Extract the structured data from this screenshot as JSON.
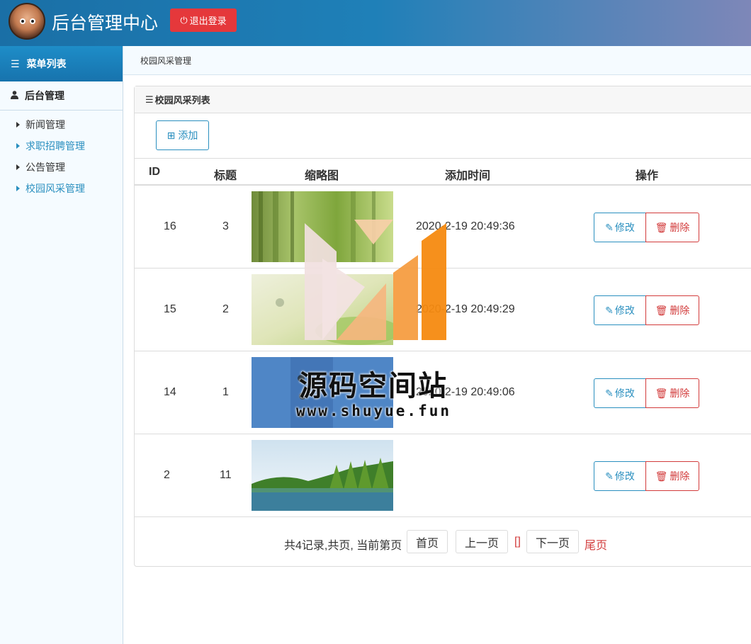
{
  "header": {
    "title": "后台管理中心",
    "logout_label": "退出登录",
    "avatar_icon": "cartoon-boy-avatar"
  },
  "sidebar": {
    "menu_title": "菜单列表",
    "group_title": "后台管理",
    "items": [
      {
        "label": "新闻管理",
        "active": false
      },
      {
        "label": "求职招聘管理",
        "active": true
      },
      {
        "label": "公告管理",
        "active": false
      },
      {
        "label": "校园风采管理",
        "active": true
      }
    ]
  },
  "breadcrumb": "校园风采管理",
  "panel": {
    "title": "校园风采列表",
    "add_label": "添加"
  },
  "table": {
    "headers": [
      "ID",
      "标题",
      "缩略图",
      "添加时间",
      "操作"
    ],
    "rows": [
      {
        "id": "16",
        "title": "3",
        "time": "2020-2-19 20:49:36",
        "edit": "修改",
        "delete": "删除",
        "thumb": "green-bamboo-scene"
      },
      {
        "id": "15",
        "title": "2",
        "time": "2020-2-19 20:49:29",
        "edit": "修改",
        "delete": "删除",
        "thumb": "light-green-meadow"
      },
      {
        "id": "14",
        "title": "1",
        "time": "2020-2-19 20:49:06",
        "edit": "修改",
        "delete": "删除",
        "thumb": "blue-collage"
      },
      {
        "id": "2",
        "title": "11",
        "time": "",
        "edit": "修改",
        "delete": "删除",
        "thumb": "lake-forest-landscape"
      }
    ]
  },
  "pager": {
    "summary": "共4记录,共页, 当前第页",
    "first": "首页",
    "prev": "上一页",
    "current": "[]",
    "next": "下一页",
    "last": "尾页"
  },
  "watermark": {
    "title": "源码空间站",
    "url": "www.shuyue.fun"
  },
  "colors": {
    "accent": "#2a8fbf",
    "danger": "#d23b3b",
    "header_start": "#1a6fa6",
    "header_end": "#7e87b8"
  }
}
